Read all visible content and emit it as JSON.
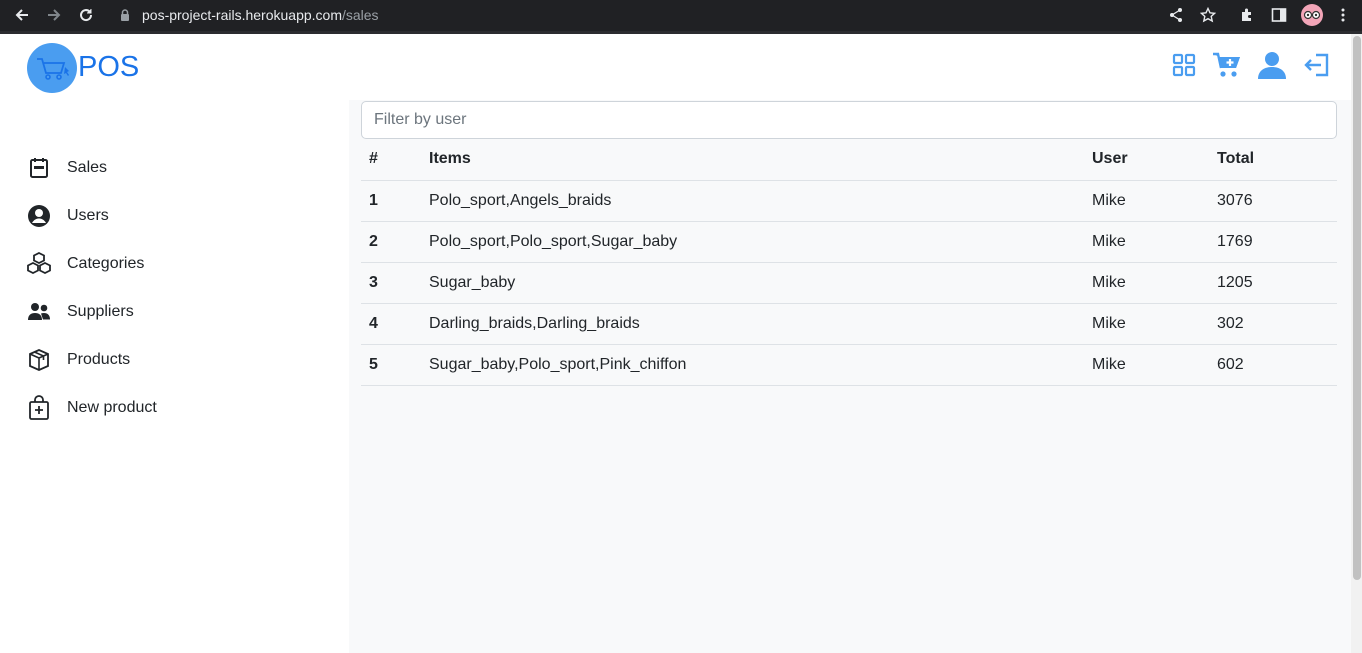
{
  "browser": {
    "url_host": "pos-project-rails.herokuapp.com",
    "url_path": "/sales"
  },
  "header": {
    "logo_text": "POS"
  },
  "sidebar": {
    "items": [
      {
        "label": "Sales",
        "icon": "calendar-icon"
      },
      {
        "label": "Users",
        "icon": "user-circle-icon"
      },
      {
        "label": "Categories",
        "icon": "boxes-icon"
      },
      {
        "label": "Suppliers",
        "icon": "people-icon"
      },
      {
        "label": "Products",
        "icon": "box-icon"
      },
      {
        "label": "New product",
        "icon": "bag-plus-icon"
      }
    ]
  },
  "filter": {
    "placeholder": "Filter by user"
  },
  "table": {
    "headers": [
      "#",
      "Items",
      "User",
      "Total"
    ],
    "rows": [
      {
        "num": "1",
        "items": "Polo_sport,Angels_braids",
        "user": "Mike",
        "total": "3076"
      },
      {
        "num": "2",
        "items": "Polo_sport,Polo_sport,Sugar_baby",
        "user": "Mike",
        "total": "1769"
      },
      {
        "num": "3",
        "items": "Sugar_baby",
        "user": "Mike",
        "total": "1205"
      },
      {
        "num": "4",
        "items": "Darling_braids,Darling_braids",
        "user": "Mike",
        "total": "302"
      },
      {
        "num": "5",
        "items": "Sugar_baby,Polo_sport,Pink_chiffon",
        "user": "Mike",
        "total": "602"
      }
    ]
  },
  "colors": {
    "brand_blue": "#4a9df0",
    "logo_text": "#1a73e8",
    "chrome_bg": "#202124"
  }
}
